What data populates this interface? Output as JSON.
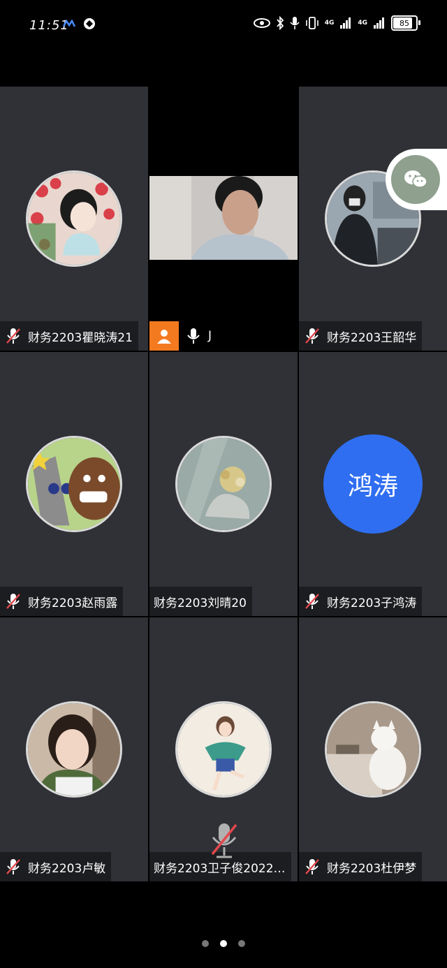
{
  "status_bar": {
    "time": "11:51",
    "network_1": "4G",
    "network_2": "4G",
    "battery": "85"
  },
  "participants": [
    {
      "name": "财务2203瞿晓涛21",
      "mic": "muted",
      "avatar": "cartoon-girl-roses"
    },
    {
      "name": "J",
      "mic": "on",
      "avatar": "live-video"
    },
    {
      "name": "财务2203王韶华",
      "mic": "muted",
      "avatar": "photo-person-rooftop"
    },
    {
      "name": "财务2203赵雨露",
      "mic": "muted",
      "avatar": "cartoon-bear"
    },
    {
      "name": "财务2203刘晴20",
      "mic": "none",
      "avatar": "cartoon-girl-flowers"
    },
    {
      "name": "财务2203子鸿涛",
      "mic": "muted",
      "avatar_text": "鸿涛",
      "avatar_color": "#2f6ef0"
    },
    {
      "name": "财务2203卢敏",
      "mic": "muted",
      "avatar": "photo-child"
    },
    {
      "name": "财务2203卫子俊2022…",
      "mic": "none",
      "avatar": "cartoon-girl-dancing"
    },
    {
      "name": "财务2203杜伊梦",
      "mic": "muted",
      "avatar": "photo-white-cat"
    }
  ],
  "pagination": {
    "total": 3,
    "active": 2
  },
  "colors": {
    "tile_bg": "#2f3136",
    "label_bg": "#1c1d20",
    "accent_orange": "#f47a20",
    "muted_red": "#e5484d"
  }
}
